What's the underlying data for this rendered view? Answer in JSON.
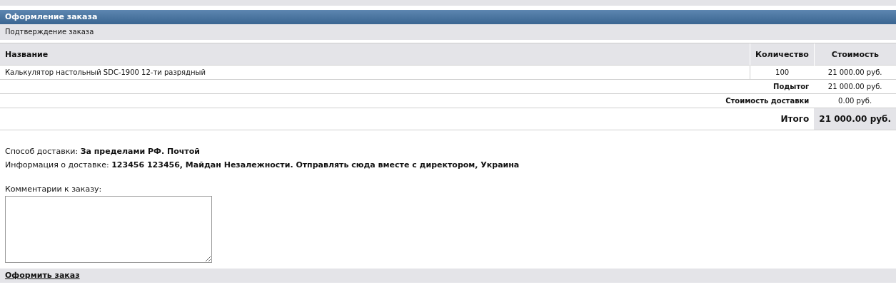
{
  "header": {
    "title": "Оформление заказа"
  },
  "subheader": {
    "text": "Подтверждение заказа"
  },
  "table": {
    "columns": [
      "Название",
      "Количество",
      "Стоимость"
    ],
    "rows": [
      {
        "name": "Калькулятор настольный SDC-1900 12-ти разрядный",
        "quantity": "100",
        "cost": "21 000.00 руб."
      }
    ],
    "summary": [
      {
        "kind": "normal",
        "label": "Подытог",
        "value": "21 000.00 руб."
      },
      {
        "kind": "normal",
        "label": "Стоимость доставки",
        "value": "0.00 руб."
      },
      {
        "kind": "total",
        "label": "Итого",
        "value": "21 000.00 руб."
      }
    ]
  },
  "details": [
    "Способ доставки: **За пределами РФ. Почтой**",
    "Информация о доставке: **123456 123456, Майдан Незалежности. Отправлять сюда вместе с директором, Украина**"
  ],
  "comment": {
    "label": "Комментарии к заказу:"
  },
  "submit": {
    "label": "Оформить заказ"
  }
}
